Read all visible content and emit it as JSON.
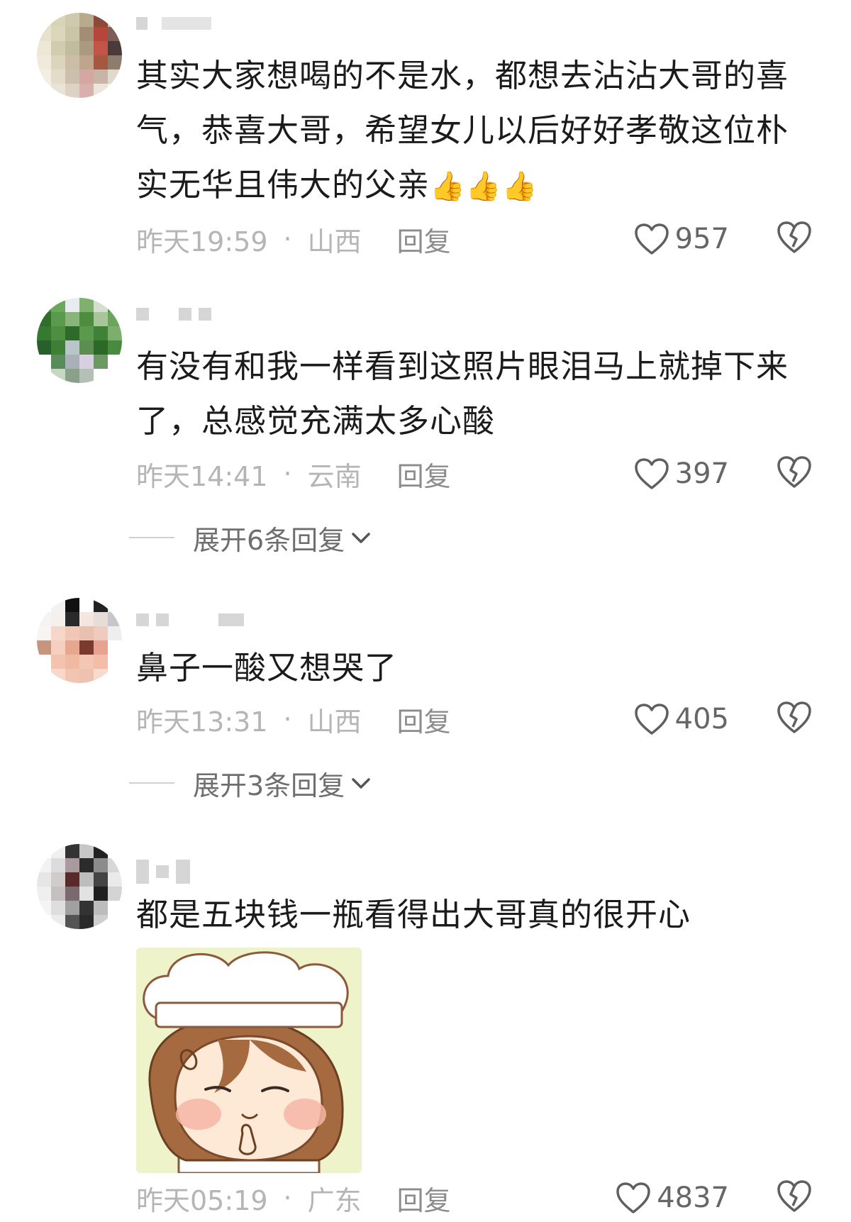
{
  "comments": [
    {
      "text": "其实大家想喝的不是水，都想去沾沾大哥的喜气，恭喜大哥，希望女儿以后好好孝敬这位朴实无华且伟大的父亲",
      "emoji": "👍👍👍",
      "time": "昨天19:59",
      "location": "山西",
      "reply": "回复",
      "likes": "957"
    },
    {
      "text": "有没有和我一样看到这照片眼泪马上就掉下来了，总感觉充满太多心酸",
      "time": "昨天14:41",
      "location": "云南",
      "reply": "回复",
      "likes": "397",
      "expand": "展开6条回复"
    },
    {
      "text": "鼻子一酸又想哭了",
      "time": "昨天13:31",
      "location": "山西",
      "reply": "回复",
      "likes": "405",
      "expand": "展开3条回复"
    },
    {
      "text": "都是五块钱一瓶看得出大哥真的很开心",
      "time": "昨天05:19",
      "location": "广东",
      "reply": "回复",
      "likes": "4837"
    }
  ],
  "separator": "·",
  "icons": {
    "like": "heart-outline-icon",
    "dislike": "broken-heart-icon",
    "expand": "chevron-down-icon"
  },
  "colors": {
    "text": "#1b1b1b",
    "meta": "#b5b5b5",
    "reply": "#8c8c8c",
    "icon": "#666666"
  }
}
